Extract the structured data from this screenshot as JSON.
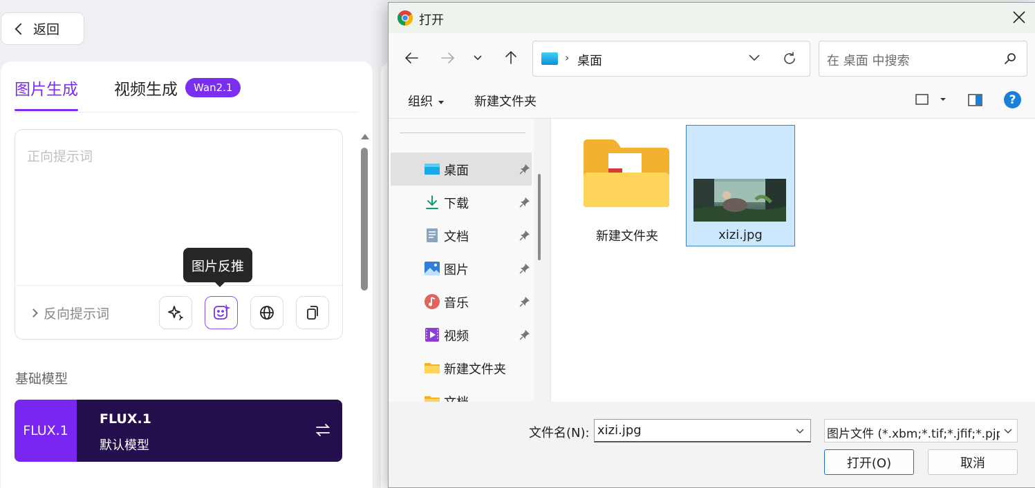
{
  "app": {
    "back_label": "返回",
    "tabs": [
      {
        "label": "图片生成"
      },
      {
        "label": "视频生成"
      }
    ],
    "video_badge": "Wan2.1",
    "prompt_placeholder": "正向提示词",
    "negative_prompt_label": "反向提示词",
    "tooltip": "图片反推",
    "section_label": "基础模型",
    "model": {
      "tag": "FLUX.1",
      "name": "FLUX.1",
      "subtitle": "默认模型"
    },
    "accent_color": "#7a2ff0"
  },
  "dialog": {
    "title": "打开",
    "breadcrumb": "桌面",
    "search_placeholder": "在 桌面 中搜索",
    "commands": {
      "organize": "组织",
      "new_folder": "新建文件夹"
    },
    "sidebar": [
      {
        "label": "桌面",
        "icon": "desktop-icon"
      },
      {
        "label": "下载",
        "icon": "download-icon"
      },
      {
        "label": "文档",
        "icon": "document-icon"
      },
      {
        "label": "图片",
        "icon": "pictures-icon"
      },
      {
        "label": "音乐",
        "icon": "music-icon"
      },
      {
        "label": "视频",
        "icon": "video-icon"
      },
      {
        "label": "新建文件夹",
        "icon": "folder-icon"
      },
      {
        "label": "文档",
        "icon": "folder-icon"
      }
    ],
    "files": [
      {
        "name": "新建文件夹",
        "type": "folder"
      },
      {
        "name": "xizi.jpg",
        "type": "image"
      }
    ],
    "filename_label": "文件名(N):",
    "filename_value": "xizi.jpg",
    "filter": "图片文件 (*.xbm;*.tif;*.jfif;*.pjp",
    "open_button": "打开(O)",
    "cancel_button": "取消"
  }
}
